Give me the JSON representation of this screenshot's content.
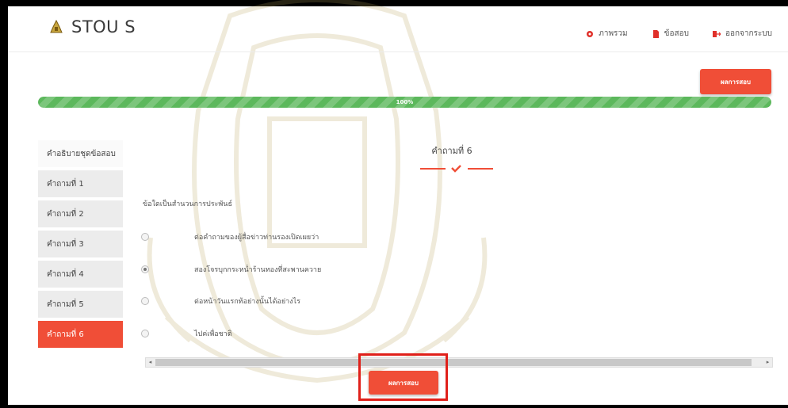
{
  "brand": {
    "name": "STOU S"
  },
  "nav": [
    {
      "label": "ภาพรวม",
      "icon": "dashboard-icon",
      "color": "#e0302a"
    },
    {
      "label": "ข้อสอบ",
      "icon": "document-icon",
      "color": "#e0302a"
    },
    {
      "label": "ออกจากระบบ",
      "icon": "logout-icon",
      "color": "#e0302a"
    }
  ],
  "result_button_label": "ผลการสอบ",
  "progress": {
    "value": 100,
    "label": "100%"
  },
  "sidebar": {
    "items": [
      {
        "label": "คำอธิบายชุดข้อสอบ"
      },
      {
        "label": "คำถามที่ 1"
      },
      {
        "label": "คำถามที่ 2"
      },
      {
        "label": "คำถามที่ 3"
      },
      {
        "label": "คำถามที่ 4"
      },
      {
        "label": "คำถามที่ 5"
      },
      {
        "label": "คำถามที่ 6"
      }
    ],
    "active_index": 6
  },
  "question": {
    "title": "คำถามที่ 6",
    "text": "ข้อใดเป็นสำนวนการประพันธ์",
    "options": [
      {
        "label": "ต่อคำถามของผู้สื่อข่าวท่านรองเปิดเผยว่า",
        "checked": false
      },
      {
        "label": "สองโจรบุกกระหน่ำร้านทองที่สะพานควาย",
        "checked": true
      },
      {
        "label": "ต่อหน้าวันแรกท้อย่างนั้นได้อย่างไร",
        "checked": false
      },
      {
        "label": "ไปค่เพื่อชาติ",
        "checked": false
      }
    ]
  },
  "colors": {
    "accent": "#f04e37",
    "progress": "#5cb85c",
    "highlight": "#e0201a"
  }
}
